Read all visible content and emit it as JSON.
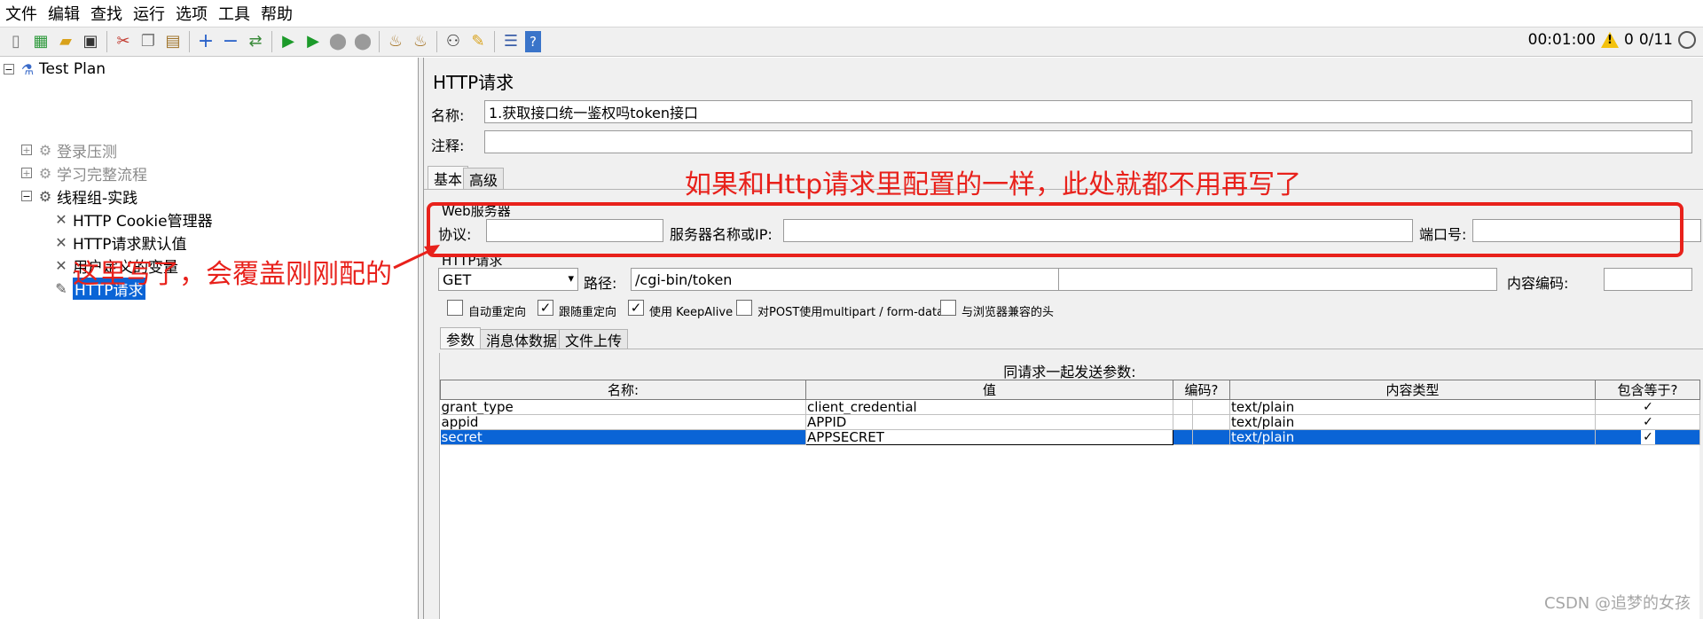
{
  "menu": [
    "文件",
    "编辑",
    "查找",
    "运行",
    "选项",
    "工具",
    "帮助"
  ],
  "toolbar": {
    "icons": [
      "new-icon",
      "templates-icon",
      "open-icon",
      "save-icon",
      "cut-icon",
      "copy-icon",
      "paste-icon",
      "expand-icon",
      "collapse-icon",
      "toggle-icon",
      "start-icon",
      "start-no-pause-icon",
      "stop-icon",
      "shutdown-icon",
      "clear-icon",
      "clear-all-icon",
      "search-icon",
      "reset-search-icon",
      "function-helper-icon",
      "help-icon"
    ],
    "elapsed": "00:01:00",
    "warnings": "0",
    "threads": "0/11"
  },
  "tree": {
    "items": [
      {
        "label": "Test Plan",
        "icon": "test-plan-icon",
        "toggle": "⊟",
        "disabled": false,
        "selected": false
      },
      {
        "label": "登录压测",
        "icon": "thread-group-icon",
        "toggle": "⊞",
        "disabled": true,
        "selected": false
      },
      {
        "label": "学习完整流程",
        "icon": "thread-group-icon",
        "toggle": "⊞",
        "disabled": true,
        "selected": false
      },
      {
        "label": "线程组-实践",
        "icon": "thread-group-icon",
        "toggle": "⊟",
        "disabled": false,
        "selected": false
      },
      {
        "label": "HTTP Cookie管理器",
        "icon": "config-element-icon",
        "toggle": "",
        "disabled": false,
        "selected": false
      },
      {
        "label": "HTTP请求默认值",
        "icon": "config-element-icon",
        "toggle": "",
        "disabled": false,
        "selected": false
      },
      {
        "label": "用户定义的变量",
        "icon": "config-element-icon",
        "toggle": "",
        "disabled": false,
        "selected": false
      },
      {
        "label": "HTTP请求",
        "icon": "sampler-icon",
        "toggle": "",
        "disabled": false,
        "selected": true
      }
    ]
  },
  "panel": {
    "title": "HTTP请求",
    "name_label": "名称:",
    "name_value": "1.获取接口统一鉴权吗token接口",
    "comment_label": "注释:",
    "comment_value": "",
    "tabs": [
      "基本",
      "高级"
    ],
    "web_server_group": "Web服务器",
    "protocol_label": "协议:",
    "protocol_value": "",
    "server_label": "服务器名称或IP:",
    "server_value": "",
    "port_label": "端口号:",
    "port_value": "",
    "http_request_group": "HTTP请求",
    "method": "GET",
    "path_label": "路径:",
    "path_value": "/cgi-bin/token",
    "encoding_label": "内容编码:",
    "encoding_value": "",
    "checkboxes": [
      {
        "label": "自动重定向",
        "checked": false
      },
      {
        "label": "跟随重定向",
        "checked": true
      },
      {
        "label": "使用 KeepAlive",
        "checked": true
      },
      {
        "label": "对POST使用multipart / form-data",
        "checked": false
      },
      {
        "label": "与浏览器兼容的头",
        "checked": false
      }
    ],
    "sub_tabs": [
      "参数",
      "消息体数据",
      "文件上传"
    ],
    "params_title": "同请求一起发送参数:",
    "params_headers": [
      "名称:",
      "值",
      "编码?",
      "",
      "内容类型",
      "包含等于?"
    ],
    "params_rows": [
      {
        "name": "grant_type",
        "value": "client_credential",
        "content_type": "text/plain",
        "include_equals": "✓",
        "selected": false
      },
      {
        "name": "appid",
        "value": "APPID",
        "content_type": "text/plain",
        "include_equals": "✓",
        "selected": false
      },
      {
        "name": "secret",
        "value": "APPSECRET",
        "content_type": "text/plain",
        "include_equals": "✓",
        "selected": true
      }
    ]
  },
  "annotations": {
    "top": "如果和Http请求里配置的一样，此处就都不用再写了",
    "left": "这里写了，会覆盖刚刚配的"
  },
  "watermark": "CSDN @追梦的女孩",
  "colors": {
    "accent": "#0a64d6",
    "annotation": "#e8211b"
  }
}
